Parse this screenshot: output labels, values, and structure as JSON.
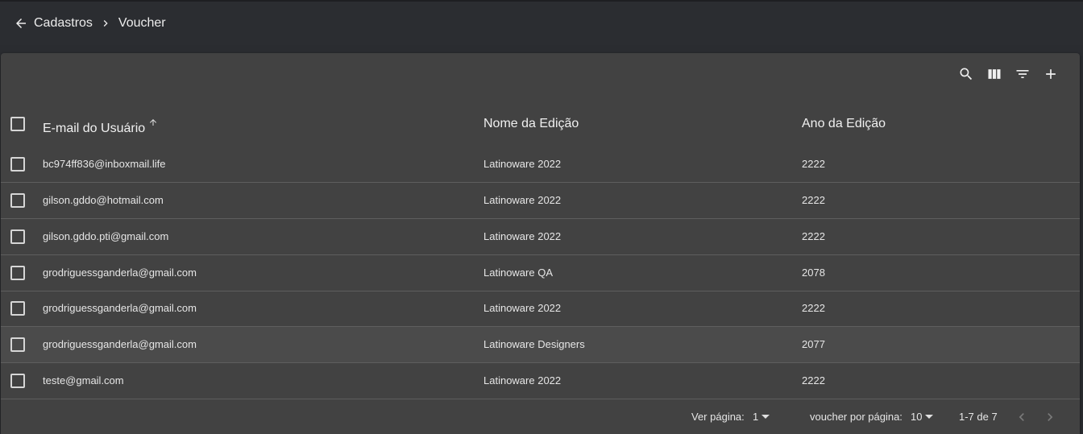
{
  "breadcrumb": {
    "back_icon": "arrow-left-icon",
    "items": [
      "Cadastros",
      "Voucher"
    ],
    "separator_icon": "chevron-right-icon"
  },
  "toolbar": {
    "icons": [
      "search-icon",
      "view-column-icon",
      "filter-icon",
      "add-icon"
    ]
  },
  "table": {
    "headers": [
      "E-mail do Usuário",
      "Nome da Edição",
      "Ano da Edição"
    ],
    "sort_icon": "arrow-up-icon",
    "rows": [
      [
        "bc974ff836@inboxmail.life",
        "Latinoware 2022",
        "2222"
      ],
      [
        "gilson.gddo@hotmail.com",
        "Latinoware 2022",
        "2222"
      ],
      [
        "gilson.gddo.pti@gmail.com",
        "Latinoware 2022",
        "2222"
      ],
      [
        "grodriguessganderla@gmail.com",
        "Latinoware QA",
        "2078"
      ],
      [
        "grodriguessganderla@gmail.com",
        "Latinoware 2022",
        "2222"
      ],
      [
        "grodriguessganderla@gmail.com",
        "Latinoware Designers",
        "2077"
      ],
      [
        "teste@gmail.com",
        "Latinoware 2022",
        "2222"
      ]
    ]
  },
  "pagination": {
    "page_label": "Ver página:",
    "page_value": "1",
    "per_page_label": "voucher por página:",
    "per_page_value": "10",
    "range_text": "1-7 de 7"
  },
  "colors": {
    "background": "#2a2c30",
    "card": "#424242",
    "highlight_row": "#4b4b4b"
  }
}
